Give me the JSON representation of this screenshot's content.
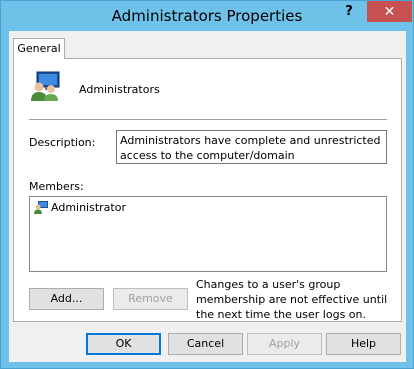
{
  "window": {
    "title": "Administrators Properties",
    "help_glyph": "?",
    "close_glyph": "✕"
  },
  "tabs": [
    {
      "label": "General"
    }
  ],
  "general": {
    "group_name": "Administrators",
    "description_label": "Description:",
    "description_value": "Administrators have complete and unrestricted access to the computer/domain",
    "members_label": "Members:",
    "members": [
      {
        "name": "Administrator",
        "icon": "user-icon"
      }
    ],
    "add_label": "Add...",
    "remove_label": "Remove",
    "note": "Changes to a user's group membership are not effective until the next time the user logs on."
  },
  "footer": {
    "ok_label": "OK",
    "cancel_label": "Cancel",
    "apply_label": "Apply",
    "help_label": "Help"
  },
  "colors": {
    "frame": "#6ec1e8",
    "close": "#c75050",
    "focus_border": "#0078d7"
  }
}
